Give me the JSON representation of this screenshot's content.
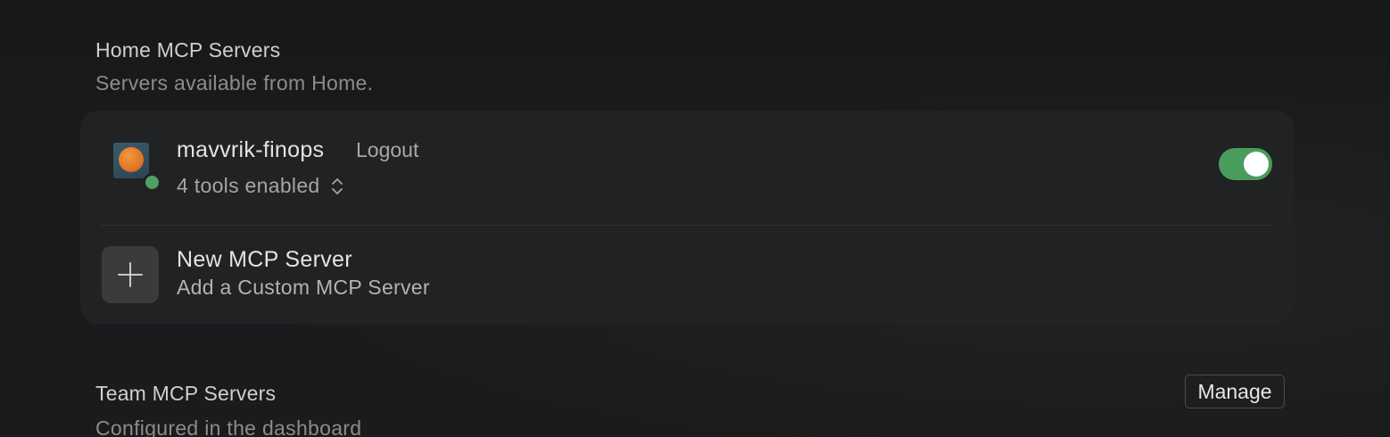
{
  "home_section": {
    "title": "Home MCP Servers",
    "subtitle": "Servers available from Home."
  },
  "servers": [
    {
      "name": "mavvrik-finops",
      "action_label": "Logout",
      "tools_summary": "4 tools enabled",
      "enabled": true,
      "status": "connected",
      "icon": "server-avatar",
      "status_color": "#4fa064"
    }
  ],
  "new_server": {
    "title": "New MCP Server",
    "subtitle": "Add a Custom MCP Server",
    "icon": "plus-icon"
  },
  "team_section": {
    "title": "Team MCP Servers",
    "subtitle": "Configured in the dashboard",
    "manage_label": "Manage"
  },
  "colors": {
    "background": "#17191b",
    "card": "#202223",
    "toggle_on": "#4a9c5c"
  }
}
